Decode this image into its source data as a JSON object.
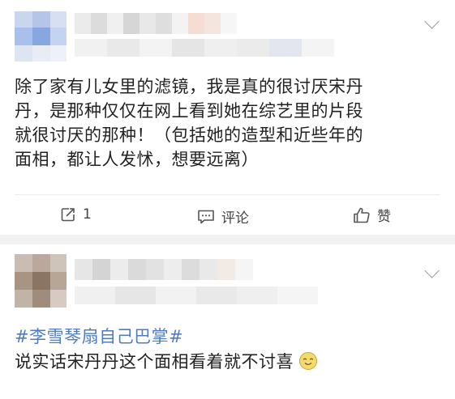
{
  "posts": [
    {
      "content_lines": [
        "除了家有儿女里的滤镜，我是真的很讨厌宋丹",
        "丹，是那种仅仅在网上看到她在综艺里的片段",
        "就很讨厌的那种！（包括她的造型和近些年的",
        "面相，都让人发怵，想要远离）"
      ],
      "actions": {
        "repost_count": "1",
        "comment_label": "评论",
        "like_label": "赞"
      }
    },
    {
      "topic": "#李雪琴扇自己巴掌#",
      "content": "说实话宋丹丹这个面相看着就不讨喜"
    }
  ],
  "icons": {
    "expand": "chevron-down-icon",
    "repost": "repost-icon",
    "comment": "comment-icon",
    "like": "thumbs-up-icon",
    "emoji": "smiling-face-emoji"
  },
  "colors": {
    "topic": "#4f7cc1",
    "text": "#222222",
    "action_text": "#444444",
    "separator": "#f2f2f2"
  }
}
